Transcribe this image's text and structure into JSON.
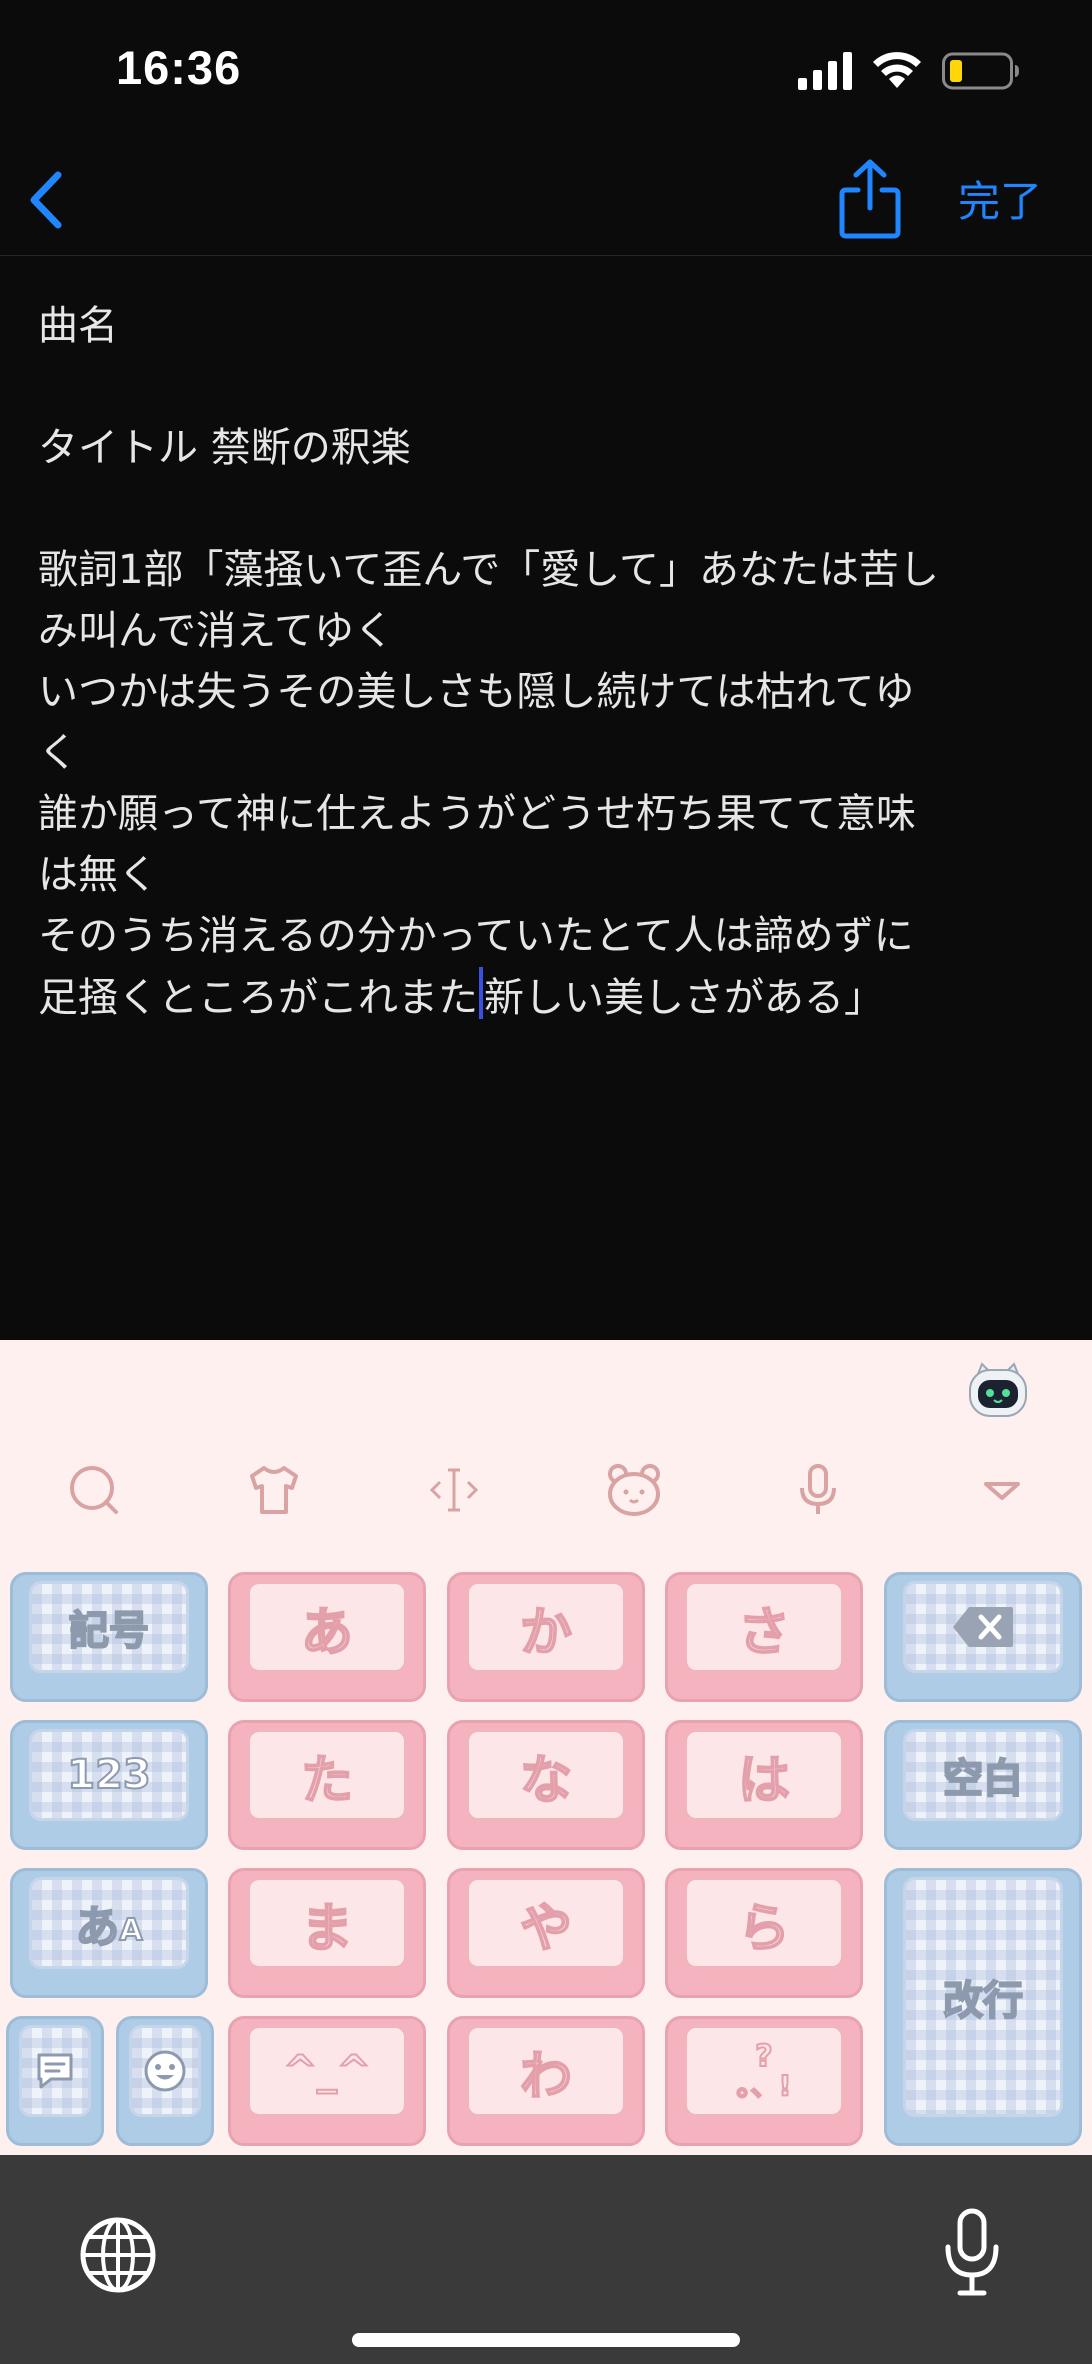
{
  "status_bar": {
    "time": "16:36"
  },
  "nav": {
    "done_label": "完了",
    "accent_color": "#1f86ff"
  },
  "note": {
    "lines": [
      "曲名",
      "",
      "タイトル 禁断の釈楽",
      "",
      "歌詞1部「藻掻いて歪んで「愛して」あなたは苦し",
      "み叫んで消えてゆく",
      "いつかは失うその美しさも隠し続けては枯れてゆ",
      "く",
      "誰か願って神に仕えようがどうせ朽ち果てて意味",
      "は無く",
      "そのうち消えるの分かっていたとて人は諦めずに"
    ],
    "last_line_before_caret": "足掻くところがこれまた",
    "last_line_after_caret": "新しい美しさがある」"
  },
  "keyboard": {
    "row1": {
      "left": "記号",
      "k1": "あ",
      "k2": "か",
      "k3": "さ"
    },
    "row2": {
      "left": "123",
      "k1": "た",
      "k2": "な",
      "k3": "は",
      "right": "空白"
    },
    "row3": {
      "left_main": "あ",
      "left_sub": "A",
      "k1": "ま",
      "k2": "や",
      "k3": "ら"
    },
    "row4": {
      "k1": "^_^",
      "k2": "わ",
      "k3_top": "?",
      "k3_bottom": "。、!"
    },
    "enter_label": "改行",
    "icons": [
      "search-icon",
      "shirt-icon",
      "cursor-move-icon",
      "bear-face-icon",
      "microphone-icon",
      "collapse-icon"
    ]
  },
  "bottom_bar": {
    "icons": [
      "globe-icon",
      "microphone-icon"
    ]
  }
}
